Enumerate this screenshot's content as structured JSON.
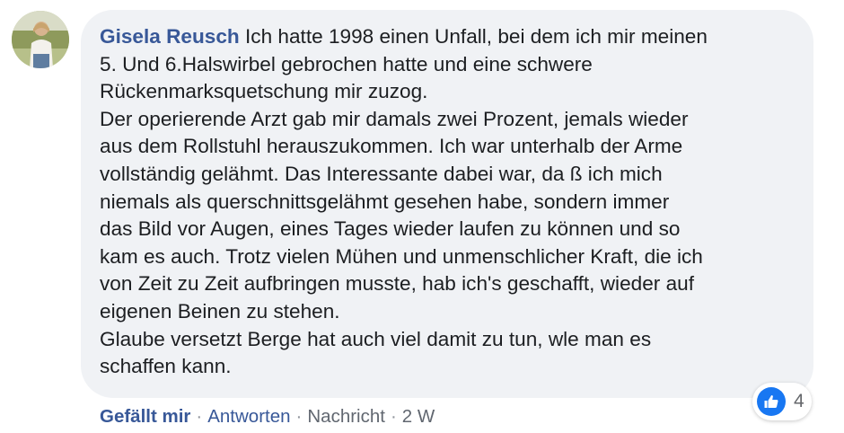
{
  "comment": {
    "author": "Gisela Reusch",
    "lines": [
      " Ich hatte 1998 einen Unfall, bei dem ich mir meinen",
      "5. Und 6.Halswirbel gebrochen hatte und eine schwere",
      "Rückenmarksquetschung mir zuzog.",
      "Der operierende Arzt gab mir damals zwei Prozent, jemals wieder",
      "aus dem Rollstuhl herauszukommen. Ich war unterhalb der Arme",
      "vollständig gelähmt. Das Interessante dabei war, da ß ich mich",
      "niemals als querschnittsgelähmt gesehen habe, sondern immer",
      "das Bild vor Augen, eines Tages wieder laufen zu können und so",
      "kam es auch. Trotz vielen Mühen und unmenschlicher Kraft, die ich",
      "von Zeit zu Zeit aufbringen musste, hab ich's geschafft, wieder auf",
      "eigenen Beinen zu stehen.",
      "Glaube versetzt Berge hat auch viel damit zu tun, wle man es",
      "schaffen kann."
    ]
  },
  "reactions": {
    "icon": "thumbs-up-icon",
    "count": "4",
    "badge_color": "#1877f2"
  },
  "actions": {
    "like": "Gefällt mir",
    "reply": "Antworten",
    "message": "Nachricht",
    "separator": "·",
    "time": "2 W"
  },
  "colors": {
    "link": "#385898",
    "bubble": "#f0f2f5",
    "text": "#1c1e21",
    "meta": "#616770"
  }
}
